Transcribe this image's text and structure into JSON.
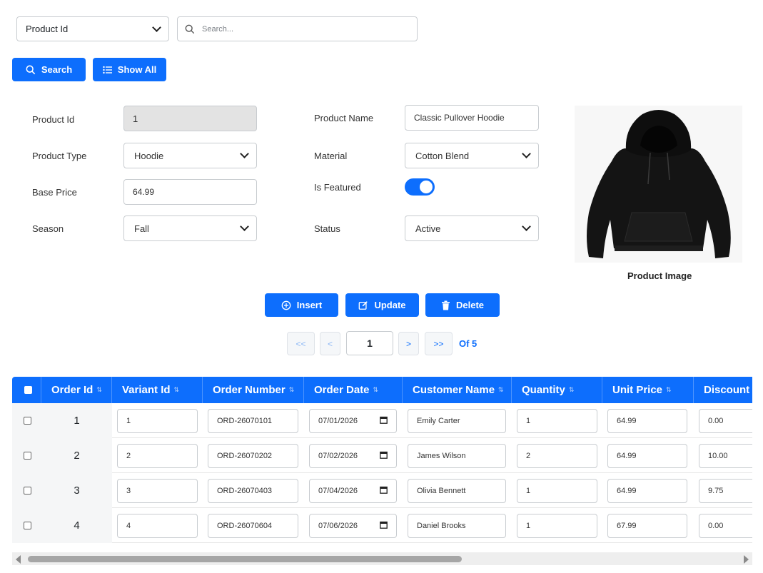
{
  "search": {
    "field_select": "Product Id",
    "placeholder": "Search...",
    "search_label": "Search",
    "show_all_label": "Show All"
  },
  "form": {
    "product_id_label": "Product Id",
    "product_id_value": "1",
    "product_type_label": "Product Type",
    "product_type_value": "Hoodie",
    "base_price_label": "Base Price",
    "base_price_value": "64.99",
    "season_label": "Season",
    "season_value": "Fall",
    "product_name_label": "Product Name",
    "product_name_value": "Classic Pullover Hoodie",
    "material_label": "Material",
    "material_value": "Cotton Blend",
    "is_featured_label": "Is Featured",
    "is_featured_value": true,
    "status_label": "Status",
    "status_value": "Active",
    "image_caption": "Product Image"
  },
  "actions": {
    "insert": "Insert",
    "update": "Update",
    "delete": "Delete"
  },
  "pager": {
    "first": "<<",
    "prev": "<",
    "page": "1",
    "next": ">",
    "last": ">>",
    "of": "Of 5"
  },
  "table": {
    "columns": [
      "Order Id",
      "Variant Id",
      "Order Number",
      "Order Date",
      "Customer Name",
      "Quantity",
      "Unit Price",
      "Discount A"
    ],
    "rows": [
      {
        "order_id": "1",
        "variant_id": "1",
        "order_number": "ORD-26070101",
        "order_date": "07/01/2026",
        "customer": "Emily Carter",
        "quantity": "1",
        "unit_price": "64.99",
        "discount": "0.00"
      },
      {
        "order_id": "2",
        "variant_id": "2",
        "order_number": "ORD-26070202",
        "order_date": "07/02/2026",
        "customer": "James Wilson",
        "quantity": "2",
        "unit_price": "64.99",
        "discount": "10.00"
      },
      {
        "order_id": "3",
        "variant_id": "3",
        "order_number": "ORD-26070403",
        "order_date": "07/04/2026",
        "customer": "Olivia Bennett",
        "quantity": "1",
        "unit_price": "64.99",
        "discount": "9.75"
      },
      {
        "order_id": "4",
        "variant_id": "4",
        "order_number": "ORD-26070604",
        "order_date": "07/06/2026",
        "customer": "Daniel Brooks",
        "quantity": "1",
        "unit_price": "67.99",
        "discount": "0.00"
      }
    ]
  },
  "colors": {
    "primary": "#0d6efd"
  }
}
